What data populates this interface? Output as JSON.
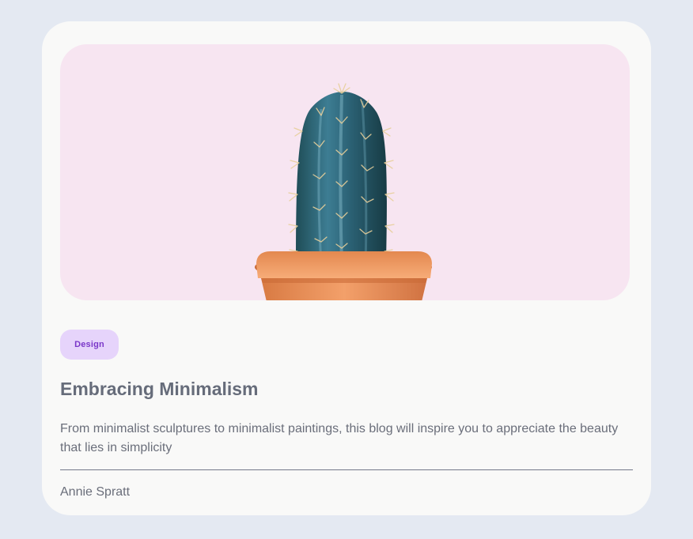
{
  "card": {
    "image_alt": "Cactus in an orange pot on a pink background",
    "tag": "Design",
    "title": "Embracing Minimalism",
    "description": "From minimalist sculptures to minimalist paintings, this blog will inspire you to appreciate the beauty that lies in simplicity",
    "author": "Annie Spratt"
  },
  "colors": {
    "page_background": "#e4e9f2",
    "card_background": "#f9f9f8",
    "image_background": "#f7e5f1",
    "tag_background": "#e6d4fb",
    "tag_text": "#7b38c9",
    "title_text": "#666c7a",
    "body_text": "#6a6e7a",
    "divider": "#73778a"
  }
}
